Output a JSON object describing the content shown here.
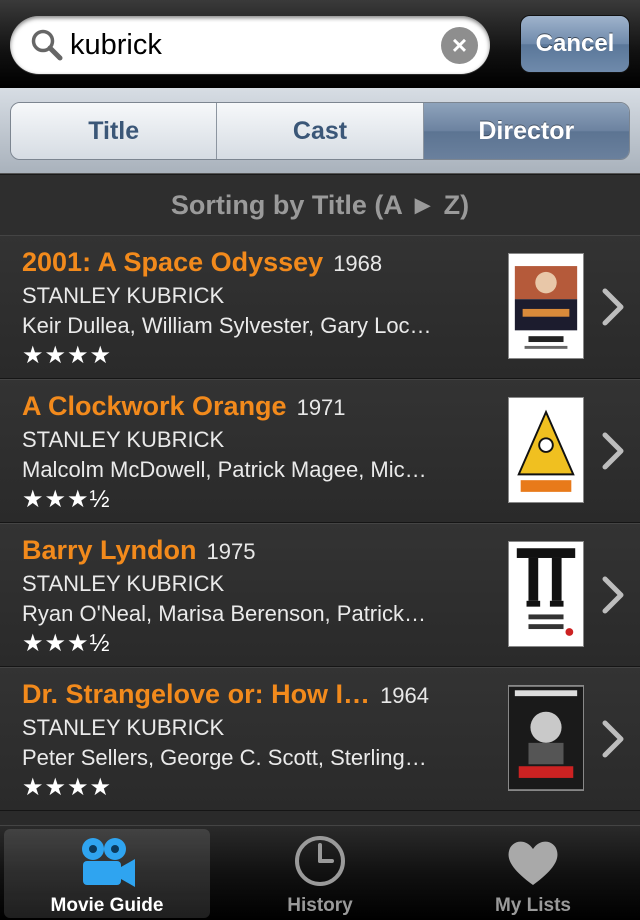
{
  "search": {
    "query": "kubrick",
    "cancel_label": "Cancel",
    "clear_glyph": "×"
  },
  "segments": [
    {
      "label": "Title",
      "active": false
    },
    {
      "label": "Cast",
      "active": false
    },
    {
      "label": "Director",
      "active": true
    }
  ],
  "sort_header": "Sorting by Title (A ► Z)",
  "movies": [
    {
      "title": "2001: A Space Odyssey",
      "year": "1968",
      "director": "STANLEY KUBRICK",
      "cast": "Keir Dullea, William Sylvester, Gary Loc…",
      "rating": "★★★★"
    },
    {
      "title": "A Clockwork Orange",
      "year": "1971",
      "director": "STANLEY KUBRICK",
      "cast": "Malcolm McDowell, Patrick Magee, Mic…",
      "rating": "★★★½"
    },
    {
      "title": "Barry Lyndon",
      "year": "1975",
      "director": "STANLEY KUBRICK",
      "cast": "Ryan O'Neal, Marisa Berenson, Patrick…",
      "rating": "★★★½"
    },
    {
      "title": "Dr. Strangelove or: How I…",
      "year": "1964",
      "director": "STANLEY KUBRICK",
      "cast": "Peter Sellers, George C. Scott, Sterling…",
      "rating": "★★★★"
    }
  ],
  "tabs": [
    {
      "label": "Movie Guide",
      "icon": "movie-camera-icon",
      "active": true
    },
    {
      "label": "History",
      "icon": "clock-icon",
      "active": false
    },
    {
      "label": "My Lists",
      "icon": "heart-icon",
      "active": false
    }
  ],
  "colors": {
    "accent": "#f28a1c",
    "active_segment": "#6c82a0"
  }
}
